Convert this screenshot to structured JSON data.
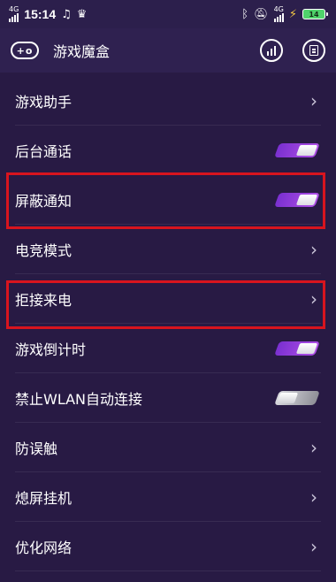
{
  "status_bar": {
    "network": "4G",
    "time": "15:14",
    "notif_icons": [
      "music-note-icon",
      "crown-icon"
    ],
    "right_icons": [
      "bluetooth-icon",
      "mute-icon",
      "signal-4g-icon"
    ],
    "battery_level": "14",
    "network_right": "4G"
  },
  "header": {
    "title": "游戏魔盒",
    "icon_glyph": "+o"
  },
  "colors": {
    "background": "#281a44",
    "toggle_on": "#9a3fe0",
    "highlight": "#d8141e"
  },
  "items": [
    {
      "label": "游戏助手",
      "control": "chevron"
    },
    {
      "label": "后台通话",
      "control": "toggle",
      "state": "on"
    },
    {
      "label": "屏蔽通知",
      "control": "toggle",
      "state": "on",
      "highlighted": true
    },
    {
      "label": "电竞模式",
      "control": "chevron"
    },
    {
      "label": "拒接来电",
      "control": "chevron",
      "highlighted": true
    },
    {
      "label": "游戏倒计时",
      "control": "toggle",
      "state": "on"
    },
    {
      "label": "禁止WLAN自动连接",
      "control": "toggle",
      "state": "off"
    },
    {
      "label": "防误触",
      "control": "chevron"
    },
    {
      "label": "熄屏挂机",
      "control": "chevron"
    },
    {
      "label": "优化网络",
      "control": "chevron"
    }
  ],
  "chevron_glyph": "›"
}
